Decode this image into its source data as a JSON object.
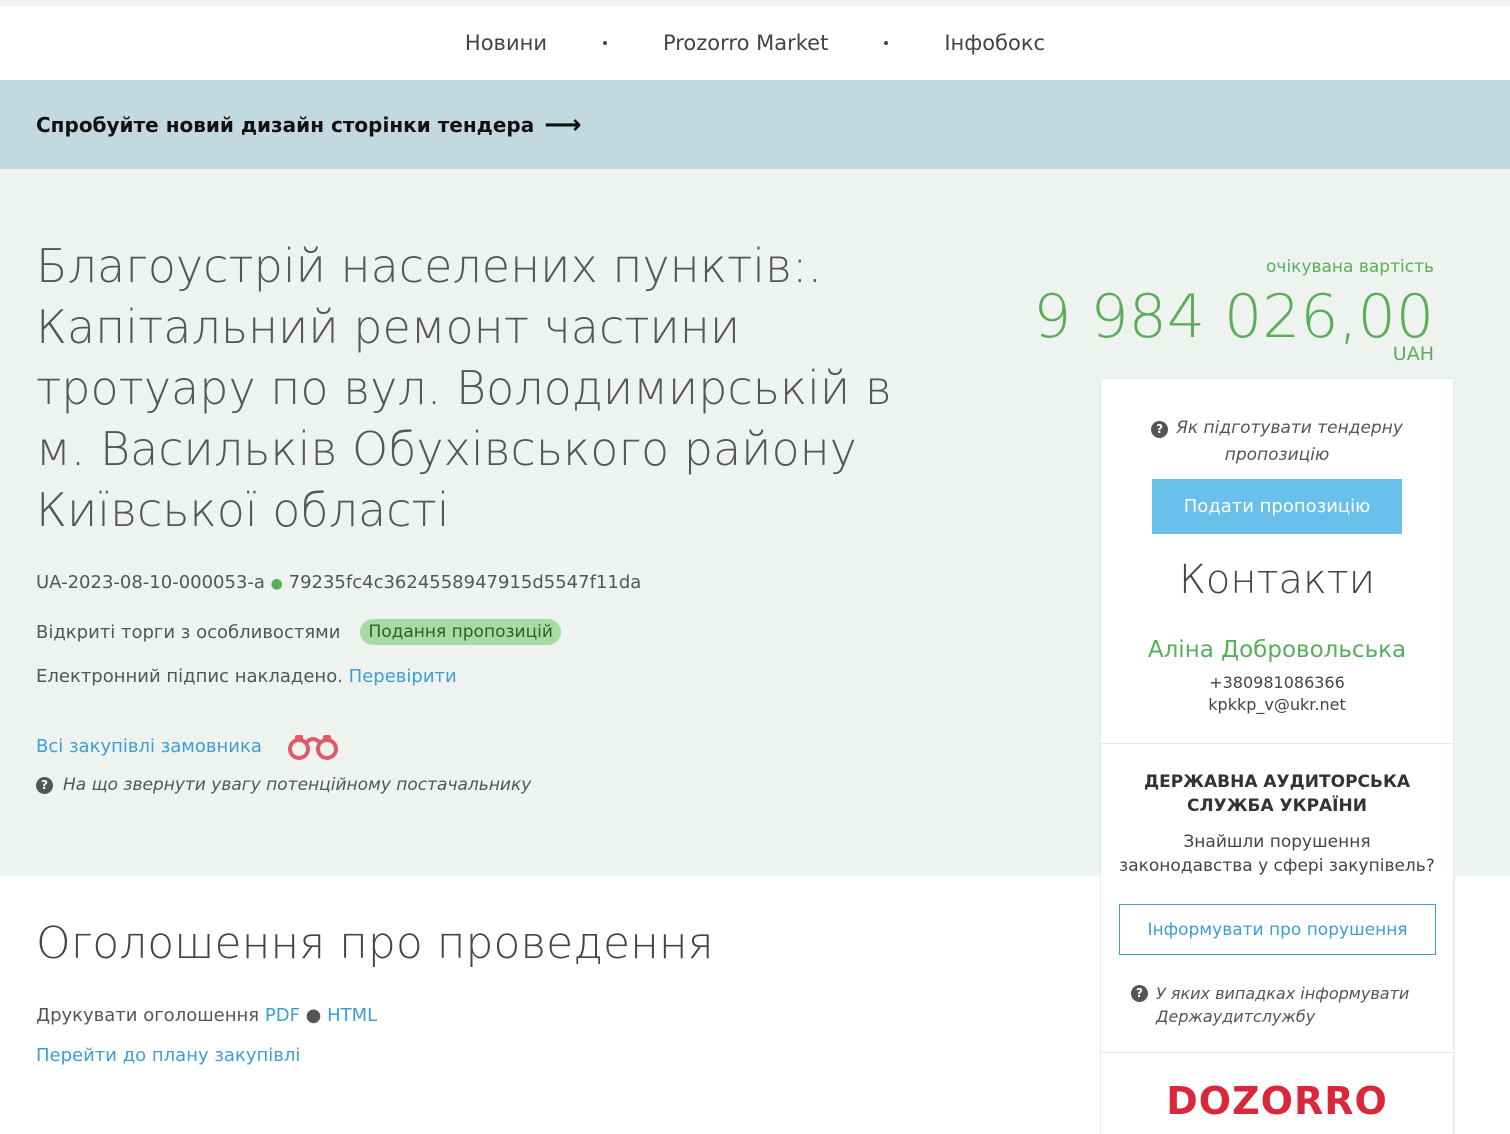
{
  "nav": {
    "items": [
      "Новини",
      "Prozorro Market",
      "Інфобокс"
    ]
  },
  "banner": {
    "text": "Спробуйте новий дизайн сторінки тендера",
    "arrow": "⟶"
  },
  "tender": {
    "title": "Благоустрій населених пунктів:. Капітальний ремонт частини тротуару по вул. Володимирській в м. Васильків Обухівського району Київської області",
    "id": "UA-2023-08-10-000053-a",
    "separator": "●",
    "hash": "79235fc4c3624558947915d5547f11da",
    "procedure": "Відкриті торги з особливостями",
    "status": "Подання пропозицій",
    "signature_text": "Електронний підпис накладено.",
    "signature_link": "Перевірити",
    "all_purchases": "Всі закупівлі замовника",
    "attention": "На що звернути увагу потенційному постачальнику"
  },
  "expected": {
    "label": "очікувана вартість",
    "value": "9 984 026,00",
    "currency": "UAH"
  },
  "sidebar": {
    "howto": "Як підготувати тендерну пропозицію",
    "submit": "Подати пропозицію",
    "contacts_title": "Контакти",
    "contact_name": "Аліна Добровольська",
    "contact_phone": "+380981086366",
    "contact_email": "kpkkp_v@ukr.net",
    "audit_title": "ДЕРЖАВНА АУДИТОРСЬКА СЛУЖБА УКРАЇНИ",
    "audit_text": "Знайшли порушення законодавства у сфері закупівель?",
    "report_button": "Інформувати про порушення",
    "when_text": "У яких випадках інформувати Держаудитслужбу",
    "logo": "DOZORRO"
  },
  "announcement": {
    "title": "Оголошення про проведення",
    "print_label": "Друкувати оголошення",
    "pdf": "PDF",
    "separator": "●",
    "html": "HTML",
    "plan_link": "Перейти до плану закупівлі"
  },
  "colors": {
    "accent_green": "#5aae5a",
    "link_blue": "#3b9ed4",
    "banner_bg": "#c2d9df",
    "hero_bg": "#eef3ef",
    "badge_bg": "#a6dca4",
    "submit_bg": "#69c0ea",
    "dozorro_red": "#d9283c"
  },
  "icons": [
    "arrow-right-icon",
    "question-circle-icon",
    "binoculars-icon"
  ]
}
